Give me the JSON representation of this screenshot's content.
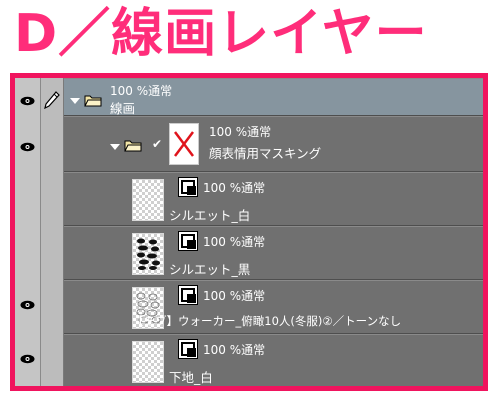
{
  "heading": "D／線画レイヤー",
  "colors": {
    "accent": "#ff2d7a",
    "frame": "#f0145e",
    "panel": "#707070",
    "selected": "#86959f"
  },
  "layers": [
    {
      "mode": "100 %通常",
      "name": "線画",
      "type": "folder",
      "visible": true,
      "selected": true,
      "expanded": true,
      "icon": "pen-icon"
    },
    {
      "mode": "100 %通常",
      "name": "顔表情用マスキング",
      "type": "folder",
      "visible": true,
      "expanded": true,
      "checked": true,
      "thumbnail": "mask-x"
    },
    {
      "mode": "100 %通常",
      "name": "シルエット_白",
      "type": "layer",
      "visible": false,
      "thumbnail": "transparent"
    },
    {
      "mode": "100 %通常",
      "name": "シルエット_黒",
      "type": "layer",
      "visible": false,
      "thumbnail": "silhouettes"
    },
    {
      "mode": "100 %通常",
      "name": "【モブ】ウォーカー_俯瞰10人(冬服)②／トーンなし",
      "type": "layer",
      "visible": true,
      "thumbnail": "figures"
    },
    {
      "mode": "100 %通常",
      "name": "下地_白",
      "type": "layer",
      "visible": true,
      "thumbnail": "transparent"
    }
  ]
}
